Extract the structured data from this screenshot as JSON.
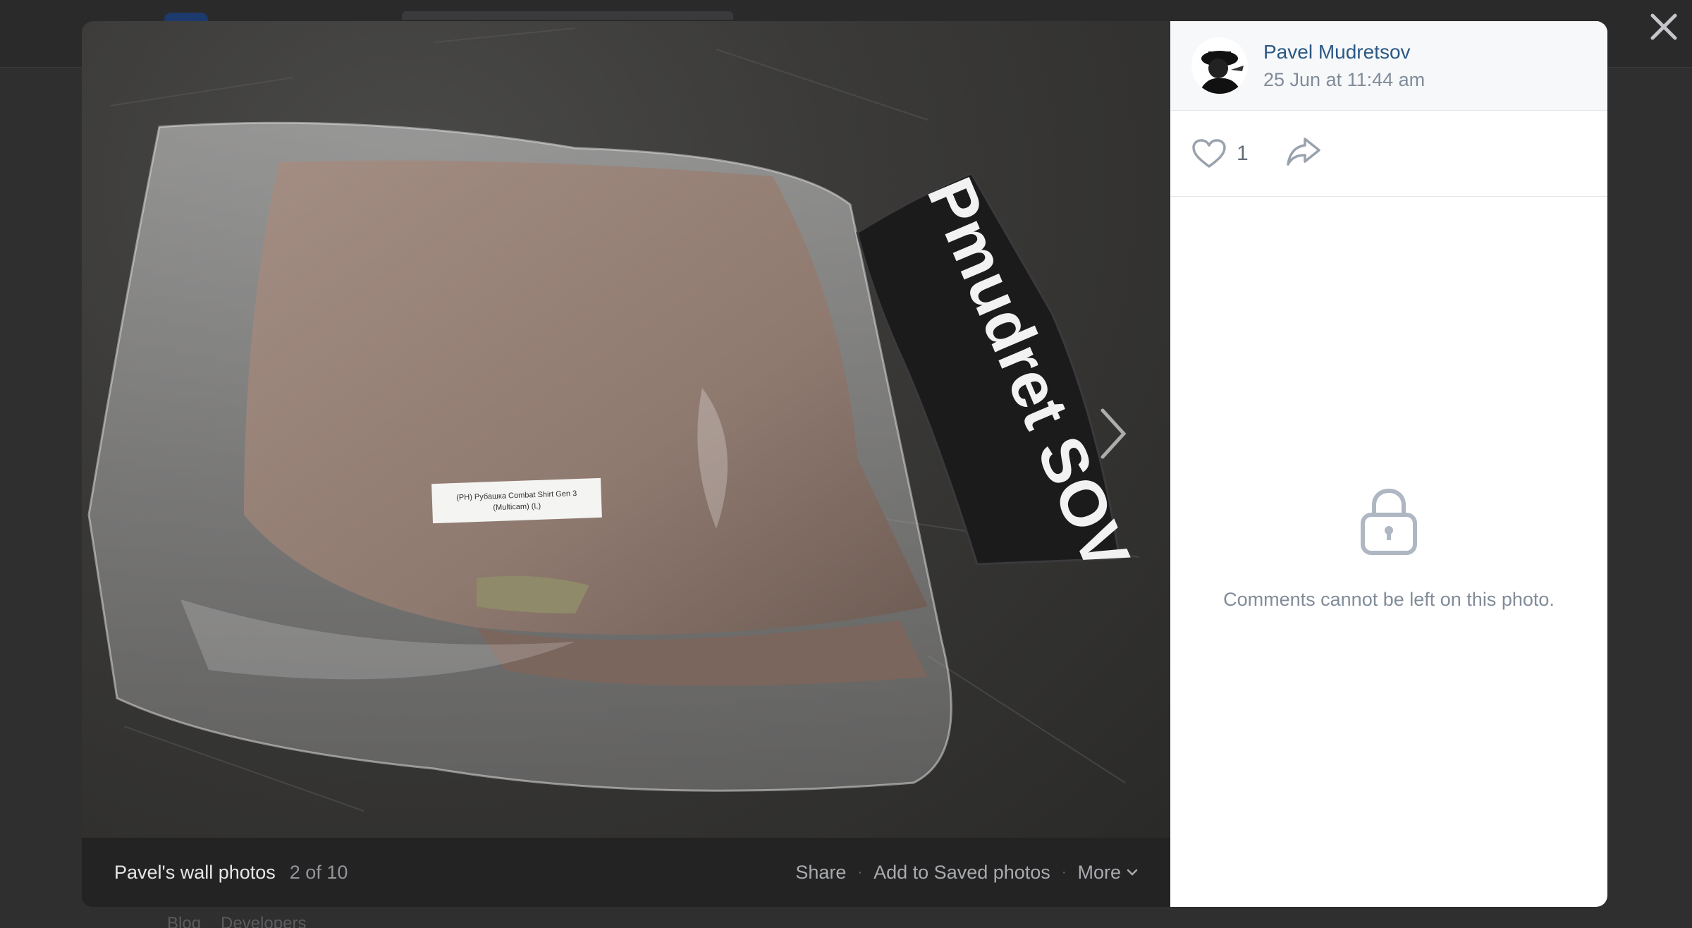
{
  "page": {
    "footer_links": [
      "Blog",
      "Developers"
    ]
  },
  "photo": {
    "album_title": "Pavel's wall photos",
    "position": "2 of 10",
    "label_text": "(PH) Рубашка Combat Shirt Gen 3 (Multicam) (L)",
    "magazine_text": "Pmudret SOV"
  },
  "bottom_bar": {
    "share_label": "Share",
    "save_label": "Add to Saved photos",
    "more_label": "More"
  },
  "post": {
    "author_name": "Pavel Mudretsov",
    "date": "25 Jun at 11:44 am",
    "likes": "1",
    "comments_locked_text": "Comments cannot be left on this photo."
  },
  "icons": {
    "close": "close-icon",
    "like": "heart-icon",
    "share": "share-arrow-icon",
    "lock": "lock-icon",
    "more": "chevron-down-icon"
  },
  "colors": {
    "link": "#2a5885",
    "muted": "#818c99",
    "bar_bg": "#232324"
  }
}
